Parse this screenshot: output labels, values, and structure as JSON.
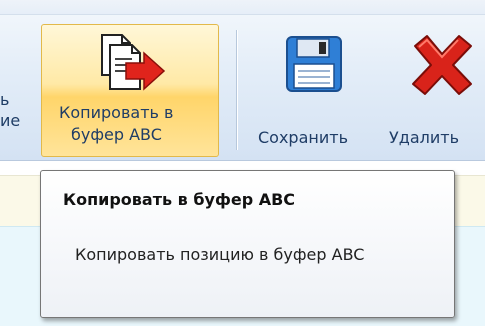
{
  "ribbon": {
    "partial_left_line1": "ь",
    "partial_left_line2": "ие",
    "copy_button": {
      "label_line1": "Копировать в",
      "label_line2": "буфер ABC",
      "icon": "copy-to-buffer-icon"
    },
    "save_button": {
      "label": "Сохранить",
      "icon": "floppy-disk-icon"
    },
    "delete_button": {
      "label": "Удалить",
      "icon": "red-x-icon"
    }
  },
  "tooltip": {
    "title": "Копировать в буфер ABC",
    "description": "Копировать позицию в буфер ABC"
  },
  "colors": {
    "accent_hover": "#ffd56a",
    "text_blue": "#1f3d66",
    "delete_red": "#d9231a",
    "save_blue": "#2f7fd6"
  }
}
